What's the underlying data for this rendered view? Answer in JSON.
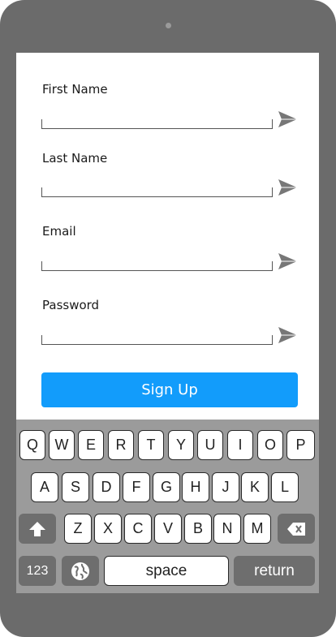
{
  "form": {
    "fields": [
      {
        "label": "First Name",
        "value": ""
      },
      {
        "label": "Last Name",
        "value": ""
      },
      {
        "label": "Email",
        "value": ""
      },
      {
        "label": "Password",
        "value": ""
      }
    ],
    "submit_label": "Sign Up"
  },
  "keyboard": {
    "row1": [
      "Q",
      "W",
      "E",
      "R",
      "T",
      "Y",
      "U",
      "I",
      "O",
      "P"
    ],
    "row2": [
      "A",
      "S",
      "D",
      "F",
      "G",
      "H",
      "J",
      "K",
      "L"
    ],
    "row3": [
      "Z",
      "X",
      "C",
      "V",
      "B",
      "N",
      "M"
    ],
    "numbers_label": "123",
    "space_label": "space",
    "return_label": "return"
  },
  "colors": {
    "accent": "#129cfb",
    "phone_body": "#6b6b6b",
    "keyboard_bg": "#9b9b9b"
  }
}
